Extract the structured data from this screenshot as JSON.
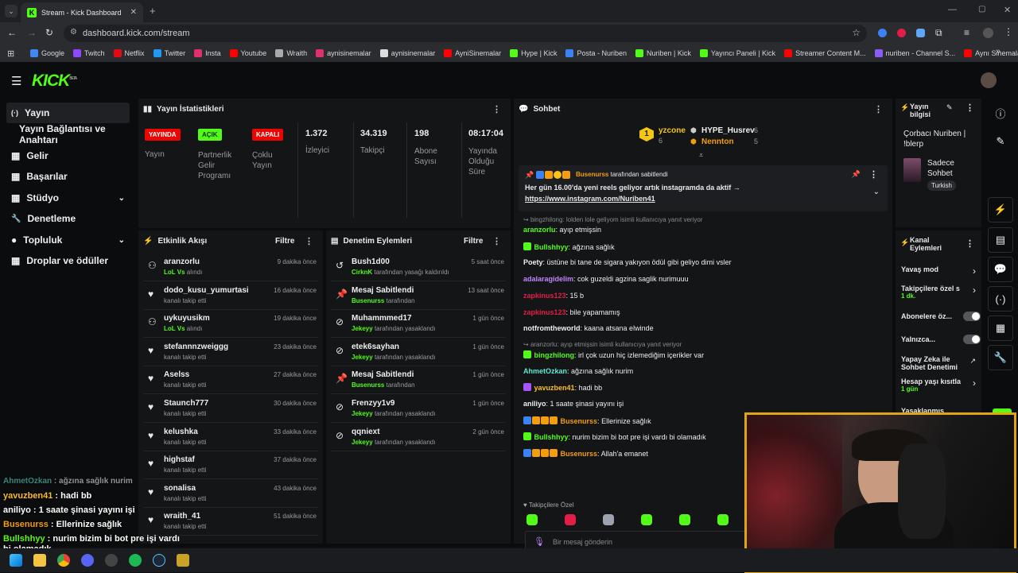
{
  "browser": {
    "tab_title": "Stream - Kick Dashboard",
    "url": "dashboard.kick.com/stream",
    "bookmarks": [
      {
        "label": "Google",
        "color": "#4285f4"
      },
      {
        "label": "Twitch",
        "color": "#9146ff"
      },
      {
        "label": "Netflix",
        "color": "#e50914"
      },
      {
        "label": "Twitter",
        "color": "#1d9bf0"
      },
      {
        "label": "Insta",
        "color": "#e1306c"
      },
      {
        "label": "Youtube",
        "color": "#ff0000"
      },
      {
        "label": "Wraith",
        "color": "#aaaaaa"
      },
      {
        "label": "aynisinemalar",
        "color": "#e1306c"
      },
      {
        "label": "aynisinemalar",
        "color": "#dddddd"
      },
      {
        "label": "AyniSinemalar",
        "color": "#ff0000"
      },
      {
        "label": "Hype | Kick",
        "color": "#53fc18"
      },
      {
        "label": "Posta - Nuriben",
        "color": "#3b82f6"
      },
      {
        "label": "Nuriben | Kick",
        "color": "#53fc18"
      },
      {
        "label": "Yayıncı Paneli | Kick",
        "color": "#53fc18"
      },
      {
        "label": "Streamer Content M...",
        "color": "#ff0000"
      },
      {
        "label": "nuriben - Channel S...",
        "color": "#8b5cf6"
      },
      {
        "label": "Aynı Sinemalar - Ça...",
        "color": "#ff0000"
      }
    ]
  },
  "logo": "KICK",
  "logo_sup": "BETA",
  "sidebar": {
    "items": [
      {
        "label": "Yayın",
        "icon": "(·)"
      },
      {
        "label": "Yayın Bağlantısı ve Anahtarı",
        "icon": ""
      },
      {
        "label": "Gelir",
        "icon": "▦"
      },
      {
        "label": "Başarılar",
        "icon": "▦"
      },
      {
        "label": "Stüdyo",
        "icon": "▦"
      },
      {
        "label": "Denetleme",
        "icon": "🔧"
      },
      {
        "label": "Topluluk",
        "icon": "●"
      },
      {
        "label": "Droplar ve ödüller",
        "icon": "▦"
      }
    ]
  },
  "stats": {
    "title": "Yayın İstatistikleri",
    "items": [
      {
        "badge": "YAYINDA",
        "badge_color": "#eb0400",
        "label": "Yayın"
      },
      {
        "badge": "AÇIK",
        "badge_color": "#53fc18",
        "label": "Partnerlik Gelir Programı"
      },
      {
        "badge": "KAPALI",
        "badge_color": "#eb0400",
        "label": "Çoklu Yayın"
      },
      {
        "value": "1.372",
        "label": "İzleyici"
      },
      {
        "value": "34.319",
        "label": "Takipçi"
      },
      {
        "value": "198",
        "label": "Abone Sayısı"
      },
      {
        "value": "08:17:04",
        "label": "Yayında Olduğu Süre"
      }
    ]
  },
  "activity": {
    "title": "Etkinlik Akışı",
    "filter": "Filtre",
    "rows": [
      {
        "name": "aranzorlu",
        "sub_green": "LoL Vs",
        "sub": "alındı",
        "time": "9 dakika önce",
        "icon": "⚇"
      },
      {
        "name": "dodo_kusu_yumurtasi",
        "sub": "kanalı takip etti",
        "time": "16 dakika önce",
        "icon": "♥"
      },
      {
        "name": "uykuyusikm",
        "sub_green": "LoL Vs",
        "sub": "alındı",
        "time": "19 dakika önce",
        "icon": "⚇"
      },
      {
        "name": "stefannnzweiggg",
        "sub": "kanalı takip etti",
        "time": "23 dakika önce",
        "icon": "♥"
      },
      {
        "name": "Aselss",
        "sub": "kanalı takip etti",
        "time": "27 dakika önce",
        "icon": "♥"
      },
      {
        "name": "Staunch777",
        "sub": "kanalı takip etti",
        "time": "30 dakika önce",
        "icon": "♥"
      },
      {
        "name": "kelushka",
        "sub": "kanalı takip etti",
        "time": "33 dakika önce",
        "icon": "♥"
      },
      {
        "name": "highstaf",
        "sub": "kanalı takip etti",
        "time": "37 dakika önce",
        "icon": "♥"
      },
      {
        "name": "sonalisa",
        "sub": "kanalı takip etti",
        "time": "43 dakika önce",
        "icon": "♥"
      },
      {
        "name": "wraith_41",
        "sub": "kanalı takip etti",
        "time": "51 dakika önce",
        "icon": "♥"
      }
    ]
  },
  "moderation": {
    "title": "Denetim Eylemleri",
    "filter": "Filtre",
    "rows": [
      {
        "name": "Bush1d00",
        "sub_green": "CirknK",
        "sub": "tarafından yasağı kaldırıldı",
        "time": "5 saat önce",
        "icon": "↺"
      },
      {
        "name": "Mesaj Sabitlendi",
        "sub_green": "Busenurss",
        "sub": "tarafından",
        "time": "13 saat önce",
        "icon": "📌"
      },
      {
        "name": "Muhammmed17",
        "sub_green": "Jekeyy",
        "sub": "tarafından yasaklandı",
        "time": "1 gün önce",
        "icon": "⊘"
      },
      {
        "name": "etek6sayhan",
        "sub_green": "Jekeyy",
        "sub": "tarafından yasaklandı",
        "time": "1 gün önce",
        "icon": "⊘"
      },
      {
        "name": "Mesaj Sabitlendi",
        "sub_green": "Busenurss",
        "sub": "tarafından",
        "time": "1 gün önce",
        "icon": "📌"
      },
      {
        "name": "Frenzyy1v9",
        "sub_green": "Jekeyy",
        "sub": "tarafından yasaklandı",
        "time": "1 gün önce",
        "icon": "⊘"
      },
      {
        "name": "qqniext",
        "sub_green": "Jekeyy",
        "sub": "tarafından yasaklandı",
        "time": "2 gün önce",
        "icon": "⊘"
      }
    ]
  },
  "chat": {
    "title": "Sohbet",
    "top_gifters": [
      {
        "rank": "1",
        "name": "yzcone",
        "count": "6"
      },
      {
        "name": "HYPE_Husrev",
        "count": "6"
      },
      {
        "name": "Nennton",
        "count": "5"
      }
    ],
    "pinned": {
      "by": "Busenurss",
      "by_suffix": "tarafından sabitlendi",
      "text": "Her gün 16.00'da yeni reels geliyor artık instagramda da aktif →",
      "link": "https://www.instagram.com/Nuriben41"
    },
    "messages": [
      {
        "reply": "bingzhilong: lolden lole geliyom isimli kullanıcıya yanıt veriyor"
      },
      {
        "user": "aranzorlu",
        "color": "#53fc18",
        "text": "ayıp etmişsin"
      },
      {
        "user": "Bullshhyy",
        "color": "#53fc18",
        "text": "ağzına sağlık",
        "badges": [
          "#53fc18"
        ]
      },
      {
        "user": "Poety",
        "color": "#f0f0f0",
        "text": "üstüne bi tane de sigara yakıyon ödül gibi geliyo dimi vsler"
      },
      {
        "user": "adalaragidelim",
        "color": "#c084fc",
        "text": "cok guzeldi agzina saglik nurimuuu"
      },
      {
        "user": "zapkinus123",
        "color": "#e11d48",
        "text": "15 b"
      },
      {
        "user": "zapkinus123",
        "color": "#e11d48",
        "text": "bile yapamamış"
      },
      {
        "user": "notfromtheworld",
        "color": "#f0f0f0",
        "text": "kaana atsana elwinde"
      },
      {
        "reply": "aranzorlu: ayıp etmişsin isimli kullanıcıya yanıt veriyor"
      },
      {
        "user": "bingzhilong",
        "color": "#53fc18",
        "text": "irl çok uzun hiç izlemediğim içerikler var",
        "badges": [
          "#53fc18"
        ]
      },
      {
        "user": "AhmetOzkan",
        "color": "#5eead4",
        "text": "ağzına sağlık nurim"
      },
      {
        "user": "yavuzben41",
        "color": "#fbbf24",
        "text": "hadi bb",
        "badges": [
          "#a855f7"
        ]
      },
      {
        "user": "aniliyo",
        "color": "#f0f0f0",
        "text": "1 saate şinasi yayını işi"
      },
      {
        "user": "Busenurss",
        "color": "#f59e0b",
        "text": "Ellerinize sağlık",
        "badges": [
          "#3b82f6",
          "#f59e0b",
          "#f59e0b",
          "#f59e0b"
        ]
      },
      {
        "user": "Bullshhyy",
        "color": "#53fc18",
        "text": "nurim bizim bi bot pre işi vardı bi olamadık",
        "badges": [
          "#53fc18"
        ]
      },
      {
        "user": "Busenurss",
        "color": "#f59e0b",
        "text": "Allah'a emanet",
        "badges": [
          "#3b82f6",
          "#f59e0b",
          "#f59e0b",
          "#f59e0b"
        ]
      }
    ],
    "followers_only": "Takipçilere Özel",
    "input_placeholder": "Bir mesaj gönderin",
    "footer_count": "0"
  },
  "stream_info": {
    "title": "Yayın bilgisi",
    "stream_title": "Çorbacı Nuriben | !blerp",
    "category": "Sadece Sohbet",
    "language": "Turkish"
  },
  "channel_actions": {
    "title": "Kanal Eylemleri",
    "items": [
      {
        "label": "Yavaş mod",
        "type": "arrow"
      },
      {
        "label": "Takipçilere özel s",
        "sub": "1 dk.",
        "type": "arrow"
      },
      {
        "label": "Abonelere öz...",
        "type": "toggle"
      },
      {
        "label": "Yalnızca...",
        "type": "toggle"
      },
      {
        "label": "Yapay Zeka ile Sohbet Denetimi",
        "type": "ext"
      },
      {
        "label": "Hesap yaşı kısıtla",
        "sub": "1 gün",
        "type": "arrow"
      },
      {
        "label": "Yasaklanmış kelim",
        "type": "none"
      }
    ]
  },
  "overlay_chat": [
    {
      "user": "AhmetOzkan",
      "color": "#5eead4",
      "text": "ağzına sağlık nurim",
      "dim": true
    },
    {
      "user": "yavuzben41",
      "color": "#fbbf24",
      "text": "hadi bb"
    },
    {
      "user": "aniliyo",
      "color": "#ffffff",
      "text": "1 saate şinasi yayını işi"
    },
    {
      "user": "Busenurss",
      "color": "#f59e0b",
      "text": "Ellerinize sağlık"
    },
    {
      "user": "Bullshhyy",
      "color": "#53fc18",
      "text": "nurim bizim bi bot pre işi vardı bi olamadık"
    }
  ],
  "colors": {
    "accent": "#53fc18",
    "live": "#eb0400",
    "panel": "#141517",
    "bg": "#0b0c0d"
  }
}
